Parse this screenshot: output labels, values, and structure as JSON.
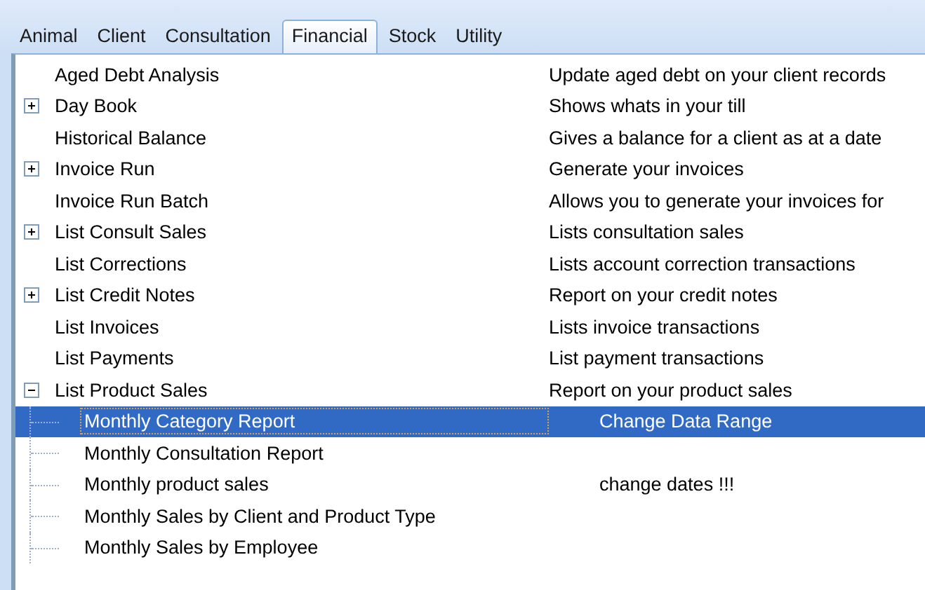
{
  "tabs": [
    {
      "label": "Animal",
      "selected": false
    },
    {
      "label": "Client",
      "selected": false
    },
    {
      "label": "Consultation",
      "selected": false
    },
    {
      "label": "Financial",
      "selected": true
    },
    {
      "label": "Stock",
      "selected": false
    },
    {
      "label": "Utility",
      "selected": false
    }
  ],
  "tree": {
    "items": [
      {
        "kind": "item",
        "name": "Aged Debt Analysis",
        "description": "Update aged debt on your client records"
      },
      {
        "kind": "group",
        "expanded": false,
        "name": "Day Book",
        "description": "Shows whats in your till"
      },
      {
        "kind": "item",
        "name": "Historical Balance",
        "description": "Gives a balance for a client as at a date"
      },
      {
        "kind": "group",
        "expanded": false,
        "name": "Invoice Run",
        "description": "Generate your invoices"
      },
      {
        "kind": "item",
        "name": "Invoice Run Batch",
        "description": "Allows you to generate your invoices for"
      },
      {
        "kind": "group",
        "expanded": false,
        "name": "List Consult Sales",
        "description": "Lists consultation sales"
      },
      {
        "kind": "item",
        "name": "List Corrections",
        "description": "Lists account correction transactions"
      },
      {
        "kind": "group",
        "expanded": false,
        "name": "List Credit Notes",
        "description": "Report on your credit notes"
      },
      {
        "kind": "item",
        "name": "List Invoices",
        "description": "Lists invoice transactions"
      },
      {
        "kind": "item",
        "name": "List Payments",
        "description": "List payment transactions"
      },
      {
        "kind": "group",
        "expanded": true,
        "name": "List Product Sales",
        "description": "Report on your product sales",
        "children": [
          {
            "name": "Monthly Category Report",
            "description": "Change Data Range",
            "selected": true
          },
          {
            "name": "Monthly Consultation Report",
            "selected": false
          },
          {
            "name": "Monthly product sales",
            "description": "change dates !!!",
            "selected": false
          },
          {
            "name": "Monthly Sales by Client and Product Type",
            "selected": false
          },
          {
            "name": "Monthly Sales by Employee",
            "selected": false
          }
        ]
      }
    ]
  }
}
